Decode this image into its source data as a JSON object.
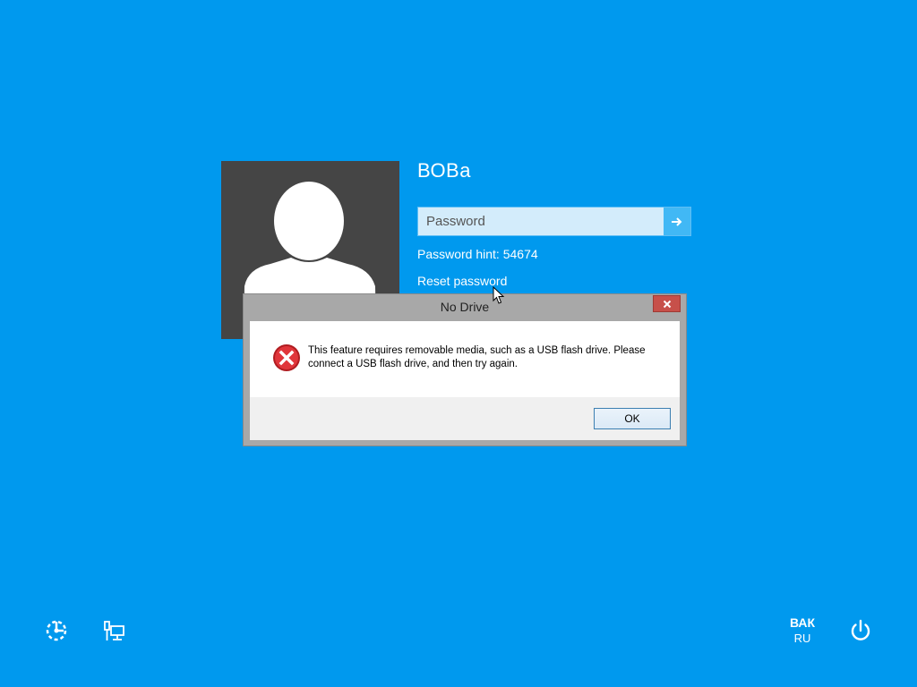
{
  "user": {
    "name": "ВОВа"
  },
  "password": {
    "placeholder": "Password",
    "submit_icon": "arrow-right-icon"
  },
  "hint": {
    "text": "Password hint: 54674"
  },
  "reset": {
    "label": "Reset password"
  },
  "dialog": {
    "title": "No Drive",
    "message": "This feature requires removable media, such as a USB flash drive. Please connect a USB flash drive, and then try again.",
    "ok_label": "OK",
    "close_icon": "close-icon",
    "icon": "error-icon"
  },
  "bottom_bar": {
    "ease_of_access_icon": "ease-of-access-icon",
    "network_icon": "network-icon",
    "language": {
      "code": "ВАК",
      "sub": "RU"
    },
    "power_icon": "power-icon"
  },
  "colors": {
    "background": "#0099ee",
    "avatar_bg": "#454545",
    "close_button": "#c7504a",
    "error_red": "#d9252b"
  }
}
